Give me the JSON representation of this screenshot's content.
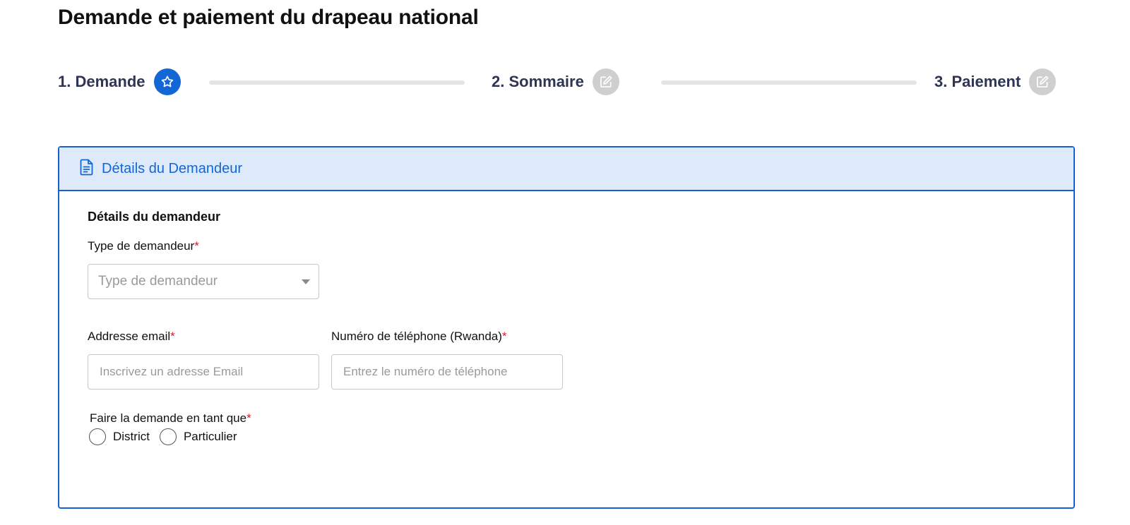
{
  "page": {
    "title": "Demande et paiement du drapeau national"
  },
  "stepper": {
    "steps": [
      {
        "label": "1. Demande",
        "icon": "star-icon",
        "state": "active"
      },
      {
        "label": "2. Sommaire",
        "icon": "edit-icon",
        "state": "inactive"
      },
      {
        "label": "3. Paiement",
        "icon": "edit-icon",
        "state": "inactive"
      }
    ]
  },
  "card": {
    "header_icon": "document-icon",
    "header_title": "Détails du Demandeur",
    "section_title": "Détails du demandeur",
    "applicant_type": {
      "label": "Type de demandeur",
      "required_mark": "*",
      "placeholder": "Type de demandeur",
      "selected_value": ""
    },
    "email": {
      "label": "Addresse email",
      "required_mark": "*",
      "placeholder": "Inscrivez un adresse Email",
      "value": ""
    },
    "phone": {
      "label": "Numéro de téléphone (Rwanda)",
      "required_mark": "*",
      "placeholder": "Entrez le numéro de téléphone",
      "value": ""
    },
    "apply_as": {
      "label": "Faire la demande en tant que",
      "required_mark": "*",
      "options": [
        {
          "label": "District",
          "checked": false
        },
        {
          "label": "Particulier",
          "checked": false
        }
      ]
    }
  },
  "colors": {
    "accent": "#1366d6",
    "card_border": "#1a5fd0",
    "header_bg": "#deeaf9",
    "required": "#e0182d",
    "step_inactive": "#cfcfcf"
  }
}
